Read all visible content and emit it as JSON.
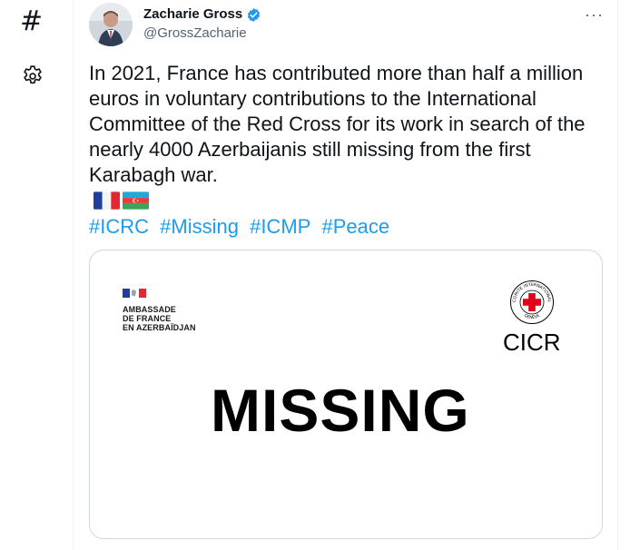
{
  "nav": {
    "explore_icon": "hash-icon",
    "settings_icon": "gear-icon"
  },
  "tweet": {
    "author_name": "Zacharie Gross",
    "author_handle": "@GrossZacharie",
    "verified": true,
    "text": "In 2021, France has contributed more than half a million euros in voluntary contributions to the International Committee of the Red Cross for its work in search of the nearly 4000 Azerbaijanis still missing from the first Karabagh war.",
    "flags": [
      "flag-france",
      "flag-azerbaijan"
    ],
    "hashtags": [
      "#ICRC",
      "#Missing",
      "#ICMP",
      "#Peace"
    ],
    "more_label": "···"
  },
  "media": {
    "embassy_lines": [
      "AMBASSADE",
      "DE FRANCE",
      "EN AZERBAÏDJAN"
    ],
    "icrc_emblem_lines": [
      "COMITE INTERNATIONAL",
      "GENEVE"
    ],
    "icrc_label": "CICR",
    "headline": "MISSING"
  },
  "colors": {
    "accent": "#1d9bf0",
    "text": "#0f1419",
    "secondary": "#536471",
    "border": "#cfd9de",
    "red_cross": "#e2001a"
  }
}
